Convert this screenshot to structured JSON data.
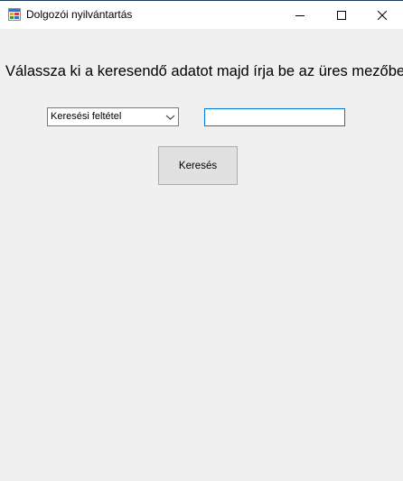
{
  "window": {
    "title": "Dolgozói nyilvántartás",
    "icon": "app-form-icon",
    "controls": {
      "minimize_icon": "minimize-icon",
      "maximize_icon": "maximize-icon",
      "close_icon": "close-icon"
    }
  },
  "form": {
    "instruction": "Válassza ki a keresendő adatot majd írja be az üres mezőbe!",
    "criteria_select": {
      "selected": "Keresési feltétel",
      "icon": "chevron-down-icon"
    },
    "search_input": {
      "value": "",
      "placeholder": ""
    },
    "search_button_label": "Keresés"
  },
  "colors": {
    "window_background": "#f0f0f0",
    "titlebar_background": "#ffffff",
    "input_focus_border": "#0078d7",
    "button_background": "#e1e1e1"
  }
}
